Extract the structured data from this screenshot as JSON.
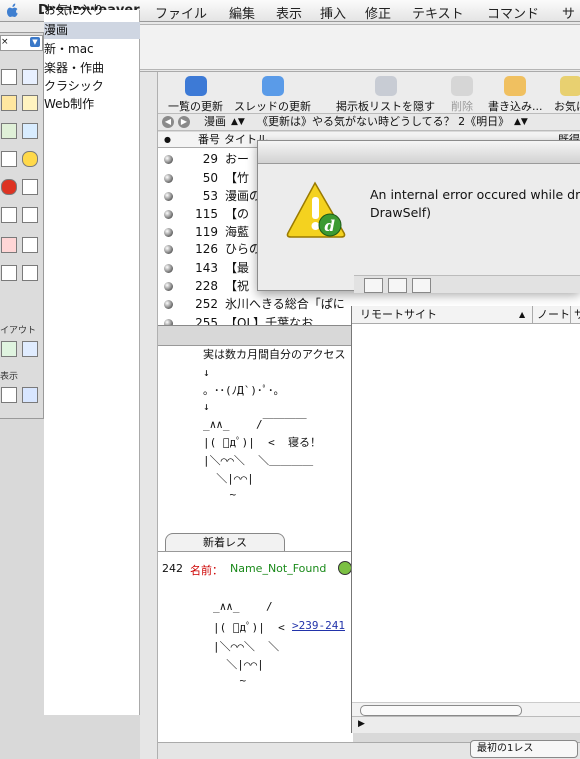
{
  "menubar": {
    "app": "Dreamweaver",
    "items": [
      "ファイル",
      "編集",
      "表示",
      "挿入",
      "修正",
      "テキスト",
      "コマンド",
      "サ"
    ]
  },
  "palette": {
    "dropdown": "×",
    "section_layout": "イアウト",
    "section_view": "表示"
  },
  "sidebar": {
    "items": [
      {
        "label": "お気に入り",
        "selected": false
      },
      {
        "label": "漫画",
        "selected": true
      },
      {
        "label": "新・mac",
        "selected": false
      },
      {
        "label": "楽器・作曲",
        "selected": false
      },
      {
        "label": "クラシック",
        "selected": false
      },
      {
        "label": "Web制作",
        "selected": false
      }
    ]
  },
  "toolbar": {
    "buttons": [
      {
        "label": "一覧の更新",
        "icon": "refresh-list-icon",
        "enabled": true
      },
      {
        "label": "スレッドの更新",
        "icon": "refresh-thread-icon",
        "enabled": true
      },
      {
        "label": "掲示板リストを隠す",
        "icon": "hide-board-list-icon",
        "enabled": true
      },
      {
        "label": "削除",
        "icon": "trash-icon",
        "enabled": false
      },
      {
        "label": "書き込み...",
        "icon": "write-pen-icon",
        "enabled": true
      },
      {
        "label": "お気に",
        "icon": "favorite-icon",
        "enabled": true
      }
    ]
  },
  "nav": {
    "board": "漫画",
    "thread": "《更新は》やる気がない時どうしてる？ 2《明日》"
  },
  "thread_list": {
    "headers": [
      "●",
      "番号",
      "タイトル",
      "既得"
    ],
    "rows": [
      {
        "no": "29",
        "title": "おー"
      },
      {
        "no": "50",
        "title": "【竹"
      },
      {
        "no": "53",
        "title": "漫画の"
      },
      {
        "no": "115",
        "title": "【の"
      },
      {
        "no": "119",
        "title": "海藍"
      },
      {
        "no": "126",
        "title": "ひらの"
      },
      {
        "no": "143",
        "title": "【最"
      },
      {
        "no": "228",
        "title": "【祝"
      },
      {
        "no": "252",
        "title": "氷川へきる総合「ぱに"
      },
      {
        "no": "255",
        "title": "【OL】千葉なお"
      }
    ]
  },
  "message": {
    "intro": "実は数カ月間自分のアクセス",
    "aa_lines": [
      "↓",
      "。･･(ﾉД`)･ﾟ･。",
      "↓",
      "_∧∧_    /￣￣￣￣",
      "|( ﾟдﾟ)|  <  寝る！",
      "|＼⌒⌒＼  ＼＿＿＿＿",
      "  ＼|⌒⌒|",
      "    ~"
    ],
    "newres_tab": "新着レス",
    "res_number": "242",
    "res_name_label": "名前：",
    "res_name": "Name_Not_Found",
    "aa2_lines": [
      "_∧∧_    /",
      "|( ﾟдﾟ)|  <",
      "|＼⌒⌒＼  ＼",
      "  ＼|⌒⌒|",
      "    ~"
    ],
    "link": ">239-241"
  },
  "remote": {
    "headers": [
      "リモートサイト",
      "ノート",
      "サ"
    ]
  },
  "dialog": {
    "message": "An internal error occured while dr\nDrawSelf)",
    "icon": "dreamweaver-caution-icon"
  },
  "bottom": {
    "select": "最初の1レス"
  }
}
